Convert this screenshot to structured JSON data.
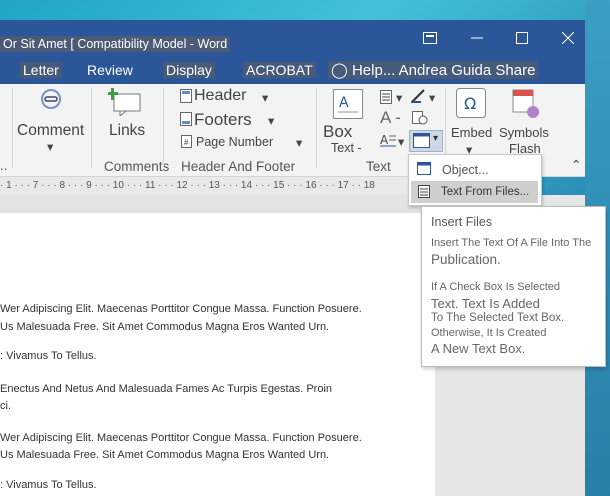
{
  "window": {
    "title": "Or Sit Amet [ Compatibility Model - Word",
    "icons": [
      "restore-ribbon-icon",
      "minimize-icon",
      "maximize-icon",
      "close-icon"
    ]
  },
  "tabs": [
    {
      "label": "Letter"
    },
    {
      "label": "Review"
    },
    {
      "label": "Display"
    },
    {
      "label": "ACROBAT"
    }
  ],
  "tell_me": {
    "label": "Help...",
    "icon": "lightbulb-icon"
  },
  "user": {
    "name": "Andrea Guida"
  },
  "share": {
    "label": "Share"
  },
  "ribbon": {
    "comments": {
      "comment_label": "Comment",
      "links_label": "Links",
      "group_label": "Comments"
    },
    "header_footer": {
      "header_label": "Header",
      "footers_label": "Footers",
      "page_number_label": "Page Number",
      "group_label": "Header And Footer"
    },
    "text": {
      "box_label": "Box",
      "text_label": "Text -",
      "group_label": "Text",
      "a_label": "A -"
    },
    "embed": {
      "label": "Embed"
    },
    "symbols": {
      "label1": "Symbols",
      "label2": "Flash"
    }
  },
  "ruler": {
    "marks": "· 1 · · · 7 · · · 8 · · · 9 · · · 10 · · · 11 · · · 12 · · · 13 · · · 14 · · · 15 · · · 16 · · · 17 · · 18"
  },
  "document": {
    "lines": [
      "Wer Adipiscing Elit. Maecenas Porttitor Congue Massa. Function Posuere.",
      "Us Malesuada Free. Sit Amet Commodus Magna Eros Wanted Urn.",
      ": Vivamus To Tellus.",
      "Enectus And Netus And Malesuada Fames Ac Turpis Egestas. Proin",
      "ci.",
      "Wer Adipiscing Elit. Maecenas Porttitor Congue Massa. Function Posuere.",
      "Us Malesuada Free. Sit Amet Commodus Magna Eros Wanted Urn.",
      ": Vivamus To Tellus."
    ]
  },
  "dropdown": {
    "items": [
      {
        "label": "Object..."
      },
      {
        "label": "Text From Files..."
      }
    ]
  },
  "tooltip": {
    "title": "Insert Files",
    "desc1": "Insert The Text Of A File Into The",
    "desc2": "Publication.",
    "desc3": "If A Check Box Is Selected",
    "desc4": "Text. Text Is Added",
    "desc5": "To The Selected Text Box.",
    "desc6": "Otherwise, It Is Created",
    "desc7": "A New Text Box."
  },
  "colors": {
    "accent": "#2b579a",
    "ribbon": "#f3f3f3",
    "highlight": "#cfcfcf"
  }
}
